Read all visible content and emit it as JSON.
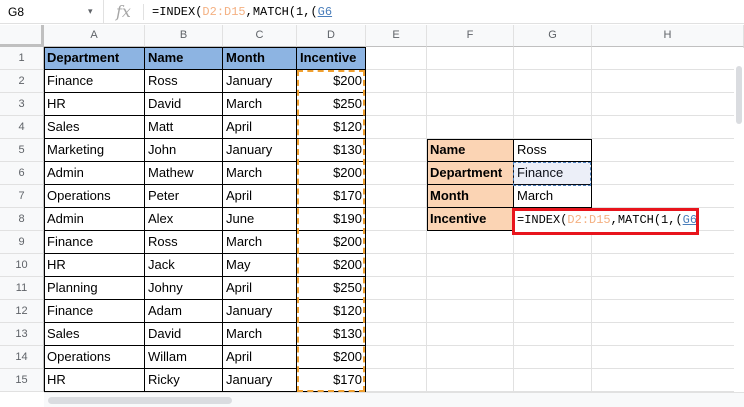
{
  "name_box": {
    "value": "G8",
    "arrow": "▾"
  },
  "formula_bar": {
    "fx": "fx",
    "parts": [
      {
        "text": "=INDEX(",
        "cls": "c-default"
      },
      {
        "text": "D2:D15",
        "cls": "c-range1"
      },
      {
        "text": ",MATCH(1,(",
        "cls": "c-default"
      },
      {
        "text": "G6",
        "cls": "c-range2"
      }
    ]
  },
  "columns": [
    "A",
    "B",
    "C",
    "D",
    "E",
    "F",
    "G",
    "H"
  ],
  "rows": [
    "1",
    "2",
    "3",
    "4",
    "5",
    "6",
    "7",
    "8",
    "9",
    "10",
    "11",
    "12",
    "13",
    "14",
    "15"
  ],
  "table": {
    "headers": [
      "Department",
      "Name",
      "Month",
      "Incentive"
    ],
    "rows": [
      [
        "Finance",
        "Ross",
        "January",
        "$200"
      ],
      [
        "HR",
        "David",
        "March",
        "$250"
      ],
      [
        "Sales",
        "Matt",
        "April",
        "$120"
      ],
      [
        "Marketing",
        "John",
        "January",
        "$130"
      ],
      [
        "Admin",
        "Mathew",
        "March",
        "$200"
      ],
      [
        "Operations",
        "Peter",
        "April",
        "$170"
      ],
      [
        "Admin",
        "Alex",
        "June",
        "$190"
      ],
      [
        "Finance",
        "Ross",
        "March",
        "$200"
      ],
      [
        "HR",
        "Jack",
        "May",
        "$200"
      ],
      [
        "Planning",
        "Johny",
        "April",
        "$250"
      ],
      [
        "Finance",
        "Adam",
        "January",
        "$120"
      ],
      [
        "Sales",
        "David",
        "March",
        "$130"
      ],
      [
        "Operations",
        "Willam",
        "April",
        "$200"
      ],
      [
        "HR",
        "Ricky",
        "January",
        "$170"
      ]
    ]
  },
  "lookup": {
    "labels": [
      "Name",
      "Department",
      "Month",
      "Incentive"
    ],
    "values": [
      "Ross",
      "Finance",
      "March"
    ],
    "formula_parts": [
      {
        "text": "=INDEX(",
        "cls": "c-default"
      },
      {
        "text": "D2:D15",
        "cls": "c-range1"
      },
      {
        "text": ",MATCH(1,(",
        "cls": "c-default"
      },
      {
        "text": "G6",
        "cls": "c-range2"
      }
    ]
  },
  "colors": {
    "header_fill": "#8db4e2",
    "label_fill": "#fbd4b4",
    "edit_border": "#e8141c",
    "copy_border": "#f0a030",
    "ref_blue": "#4a7ebb",
    "range_orange": "#f4b183"
  }
}
